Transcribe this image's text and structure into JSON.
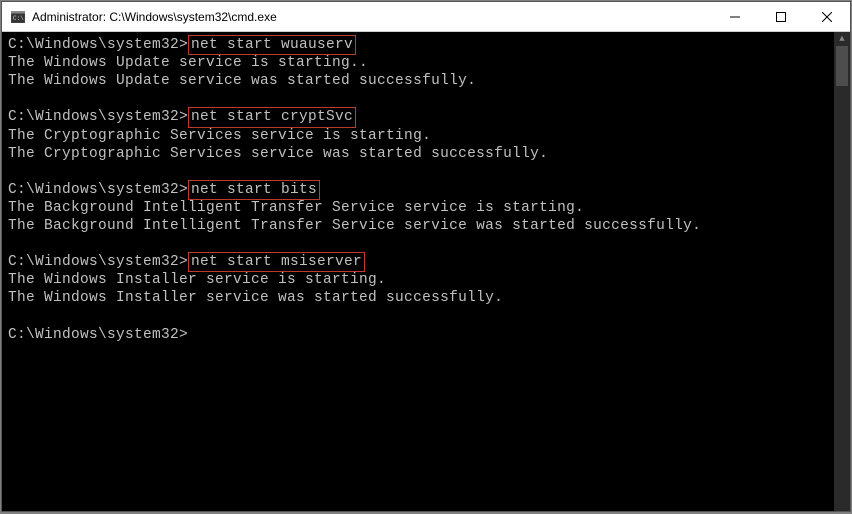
{
  "window": {
    "title": "Administrator: C:\\Windows\\system32\\cmd.exe"
  },
  "prompt": "C:\\Windows\\system32>",
  "blocks": [
    {
      "command": "net start wuauserv",
      "output": [
        "The Windows Update service is starting..",
        "The Windows Update service was started successfully."
      ]
    },
    {
      "command": "net start cryptSvc",
      "output": [
        "The Cryptographic Services service is starting.",
        "The Cryptographic Services service was started successfully."
      ]
    },
    {
      "command": "net start bits",
      "output": [
        "The Background Intelligent Transfer Service service is starting.",
        "The Background Intelligent Transfer Service service was started successfully."
      ]
    },
    {
      "command": "net start msiserver",
      "output": [
        "The Windows Installer service is starting.",
        "The Windows Installer service was started successfully."
      ]
    }
  ],
  "final_prompt": "C:\\Windows\\system32>"
}
